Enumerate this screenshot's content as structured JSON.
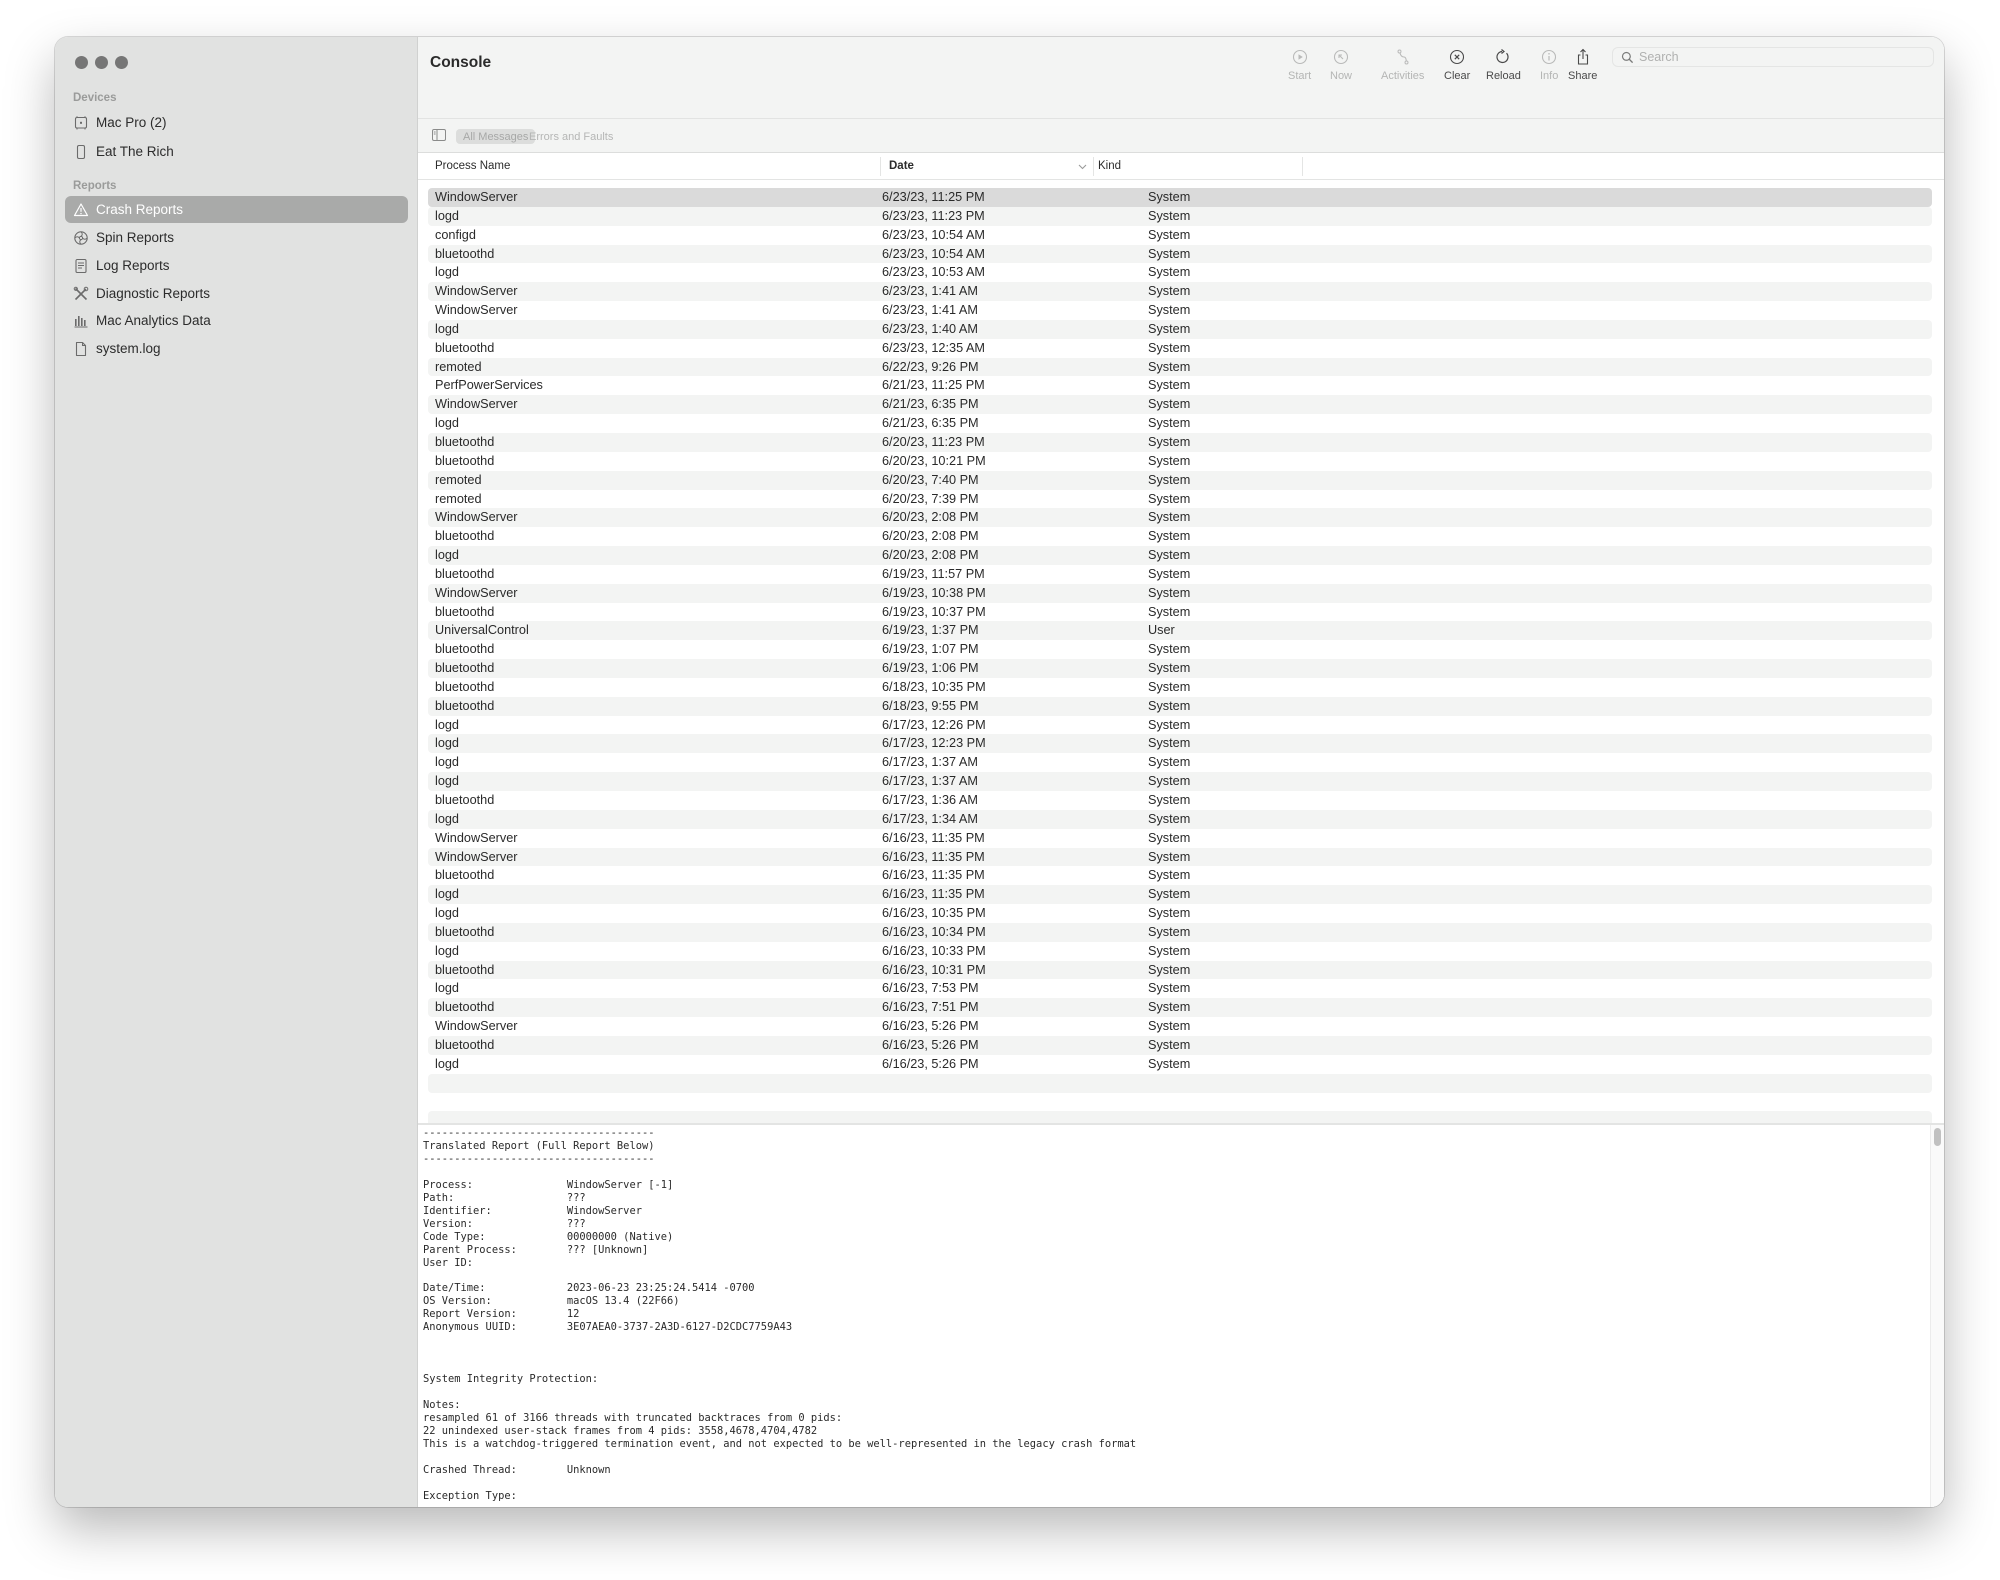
{
  "window": {
    "title": "Console"
  },
  "sidebar": {
    "devices_label": "Devices",
    "devices": [
      {
        "label": "Mac Pro (2)",
        "icon": "mac-pro-icon"
      },
      {
        "label": "Eat The Rich",
        "icon": "iphone-icon"
      }
    ],
    "reports_label": "Reports",
    "reports": [
      {
        "label": "Crash Reports",
        "icon": "warning-triangle-icon",
        "selected": true
      },
      {
        "label": "Spin Reports",
        "icon": "spin-wheel-icon"
      },
      {
        "label": "Log Reports",
        "icon": "document-lines-icon"
      },
      {
        "label": "Diagnostic Reports",
        "icon": "tools-icon"
      },
      {
        "label": "Mac Analytics Data",
        "icon": "bar-chart-icon"
      },
      {
        "label": "system.log",
        "icon": "document-icon"
      }
    ]
  },
  "toolbar": {
    "buttons": [
      {
        "label": "Start",
        "icon": "play-circle-icon",
        "enabled": false
      },
      {
        "label": "Now",
        "icon": "arrow-up-left-circle-icon",
        "enabled": false
      },
      {
        "label": "Activities",
        "icon": "activities-icon",
        "enabled": false
      },
      {
        "label": "Clear",
        "icon": "clear-x-circle-icon",
        "enabled": true
      },
      {
        "label": "Reload",
        "icon": "reload-icon",
        "enabled": true
      },
      {
        "label": "Info",
        "icon": "info-circle-icon",
        "enabled": false
      },
      {
        "label": "Share",
        "icon": "share-icon",
        "enabled": true
      }
    ],
    "search_placeholder": "Search",
    "search_value": ""
  },
  "filter": {
    "all_messages": "All Messages",
    "errors_and_faults": "Errors and Faults",
    "active": "All Messages"
  },
  "table": {
    "columns": [
      "Process Name",
      "Date",
      "Kind"
    ],
    "sort_column": "Date",
    "sort_direction": "descending",
    "rows": [
      [
        "WindowServer",
        "6/23/23, 11:25 PM",
        "System"
      ],
      [
        "logd",
        "6/23/23, 11:23 PM",
        "System"
      ],
      [
        "configd",
        "6/23/23, 10:54 AM",
        "System"
      ],
      [
        "bluetoothd",
        "6/23/23, 10:54 AM",
        "System"
      ],
      [
        "logd",
        "6/23/23, 10:53 AM",
        "System"
      ],
      [
        "WindowServer",
        "6/23/23, 1:41 AM",
        "System"
      ],
      [
        "WindowServer",
        "6/23/23, 1:41 AM",
        "System"
      ],
      [
        "logd",
        "6/23/23, 1:40 AM",
        "System"
      ],
      [
        "bluetoothd",
        "6/23/23, 12:35 AM",
        "System"
      ],
      [
        "remoted",
        "6/22/23, 9:26 PM",
        "System"
      ],
      [
        "PerfPowerServices",
        "6/21/23, 11:25 PM",
        "System"
      ],
      [
        "WindowServer",
        "6/21/23, 6:35 PM",
        "System"
      ],
      [
        "logd",
        "6/21/23, 6:35 PM",
        "System"
      ],
      [
        "bluetoothd",
        "6/20/23, 11:23 PM",
        "System"
      ],
      [
        "bluetoothd",
        "6/20/23, 10:21 PM",
        "System"
      ],
      [
        "remoted",
        "6/20/23, 7:40 PM",
        "System"
      ],
      [
        "remoted",
        "6/20/23, 7:39 PM",
        "System"
      ],
      [
        "WindowServer",
        "6/20/23, 2:08 PM",
        "System"
      ],
      [
        "bluetoothd",
        "6/20/23, 2:08 PM",
        "System"
      ],
      [
        "logd",
        "6/20/23, 2:08 PM",
        "System"
      ],
      [
        "bluetoothd",
        "6/19/23, 11:57 PM",
        "System"
      ],
      [
        "WindowServer",
        "6/19/23, 10:38 PM",
        "System"
      ],
      [
        "bluetoothd",
        "6/19/23, 10:37 PM",
        "System"
      ],
      [
        "UniversalControl",
        "6/19/23, 1:37 PM",
        "User"
      ],
      [
        "bluetoothd",
        "6/19/23, 1:07 PM",
        "System"
      ],
      [
        "bluetoothd",
        "6/19/23, 1:06 PM",
        "System"
      ],
      [
        "bluetoothd",
        "6/18/23, 10:35 PM",
        "System"
      ],
      [
        "bluetoothd",
        "6/18/23, 9:55 PM",
        "System"
      ],
      [
        "logd",
        "6/17/23, 12:26 PM",
        "System"
      ],
      [
        "logd",
        "6/17/23, 12:23 PM",
        "System"
      ],
      [
        "logd",
        "6/17/23, 1:37 AM",
        "System"
      ],
      [
        "logd",
        "6/17/23, 1:37 AM",
        "System"
      ],
      [
        "bluetoothd",
        "6/17/23, 1:36 AM",
        "System"
      ],
      [
        "logd",
        "6/17/23, 1:34 AM",
        "System"
      ],
      [
        "WindowServer",
        "6/16/23, 11:35 PM",
        "System"
      ],
      [
        "WindowServer",
        "6/16/23, 11:35 PM",
        "System"
      ],
      [
        "bluetoothd",
        "6/16/23, 11:35 PM",
        "System"
      ],
      [
        "logd",
        "6/16/23, 11:35 PM",
        "System"
      ],
      [
        "logd",
        "6/16/23, 10:35 PM",
        "System"
      ],
      [
        "bluetoothd",
        "6/16/23, 10:34 PM",
        "System"
      ],
      [
        "logd",
        "6/16/23, 10:33 PM",
        "System"
      ],
      [
        "bluetoothd",
        "6/16/23, 10:31 PM",
        "System"
      ],
      [
        "logd",
        "6/16/23, 7:53 PM",
        "System"
      ],
      [
        "bluetoothd",
        "6/16/23, 7:51 PM",
        "System"
      ],
      [
        "WindowServer",
        "6/16/23, 5:26 PM",
        "System"
      ],
      [
        "bluetoothd",
        "6/16/23, 5:26 PM",
        "System"
      ],
      [
        "logd",
        "6/16/23, 5:26 PM",
        "System"
      ]
    ],
    "selected_index": 0
  },
  "detail": {
    "report_text": "-------------------------------------\nTranslated Report (Full Report Below)\n-------------------------------------\n\nProcess:               WindowServer [-1]\nPath:                  ???\nIdentifier:            WindowServer\nVersion:               ???\nCode Type:             00000000 (Native)\nParent Process:        ??? [Unknown]\nUser ID:\n\nDate/Time:             2023-06-23 23:25:24.5414 -0700\nOS Version:            macOS 13.4 (22F66)\nReport Version:        12\nAnonymous UUID:        3E07AEA0-3737-2A3D-6127-D2CDC7759A43\n\n\n\nSystem Integrity Protection:\n\nNotes:\nresampled 61 of 3166 threads with truncated backtraces from 0 pids:\n22 unindexed user-stack frames from 4 pids: 3558,4678,4704,4782\nThis is a watchdog-triggered termination event, and not expected to be well-represented in the legacy crash format\n\nCrashed Thread:        Unknown\n\nException Type:"
  }
}
